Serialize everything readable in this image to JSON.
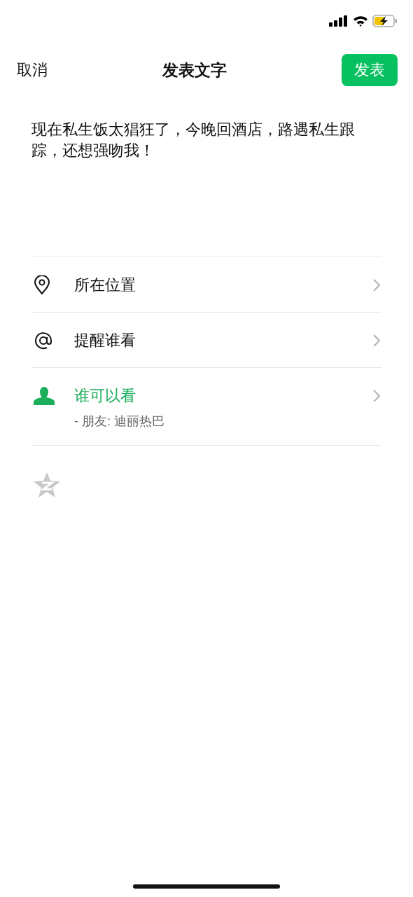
{
  "nav": {
    "cancel": "取消",
    "title": "发表文字",
    "publish": "发表"
  },
  "post_text": "现在私生饭太猖狂了，今晚回酒店，路遇私生跟踪，还想强吻我！",
  "options": [
    {
      "kind": "location",
      "label": "所在位置",
      "highlighted": false
    },
    {
      "kind": "mention",
      "label": "提醒谁看",
      "highlighted": false
    },
    {
      "kind": "visibility",
      "label": "谁可以看",
      "detail": "- 朋友: 迪丽热巴",
      "highlighted": true
    }
  ]
}
